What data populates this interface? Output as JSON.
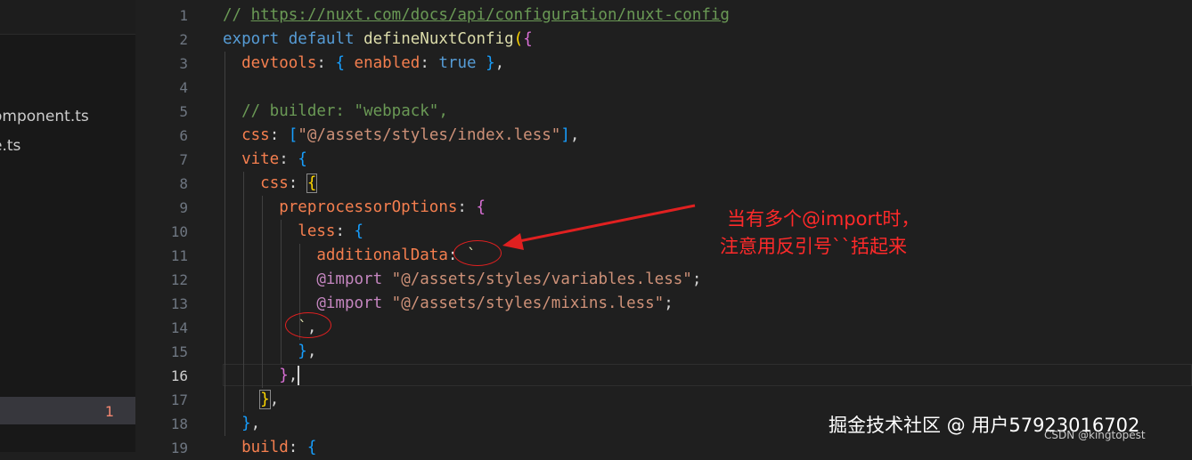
{
  "sidebar": {
    "files": [
      "omponent.ts",
      "e.ts"
    ],
    "problem_count": "1"
  },
  "editor": {
    "line_numbers": [
      "1",
      "2",
      "3",
      "4",
      "5",
      "6",
      "7",
      "8",
      "9",
      "10",
      "11",
      "12",
      "13",
      "14",
      "15",
      "16",
      "17",
      "18",
      "19"
    ],
    "active_line": "16",
    "code": {
      "l1_comment": "// ",
      "l1_url": "https://nuxt.com/docs/api/configuration/nuxt-config",
      "l2_export": "export",
      "l2_default": "default",
      "l2_fn": "defineNuxtConfig",
      "paren_open": "(",
      "brace_open": "{",
      "brace_close": "}",
      "l3_key": "devtools",
      "l3_enabled": "enabled",
      "l3_true": "true",
      "l5_comment": "// builder: \"webpack\",",
      "l6_key": "css",
      "l6_value": "\"@/assets/styles/index.less\"",
      "bracket_open": "[",
      "bracket_close": "]",
      "l7_key": "vite",
      "l8_key": "css",
      "l9_key": "preprocessorOptions",
      "l10_key": "less",
      "l11_key": "additionalData",
      "backtick": "`",
      "at_import": "@import",
      "l12_path": "\"@/assets/styles/variables.less\"",
      "l13_path": "\"@/assets/styles/mixins.less\"",
      "l19_key": "build",
      "colon": ": ",
      "comma": ",",
      "semicolon": ";"
    }
  },
  "annotation": {
    "line1": "当有多个@import时，",
    "line2": "注意用反引号``括起来"
  },
  "watermark": {
    "main": "掘金技术社区 @ 用户57923016702",
    "csdn": "CSDN @kingtopest"
  },
  "colors": {
    "background": "#1f1f1f",
    "annotation_red": "#ff2a2a",
    "keyword": "#569cd6",
    "property": "#f57f4f",
    "string": "#ce9178"
  }
}
